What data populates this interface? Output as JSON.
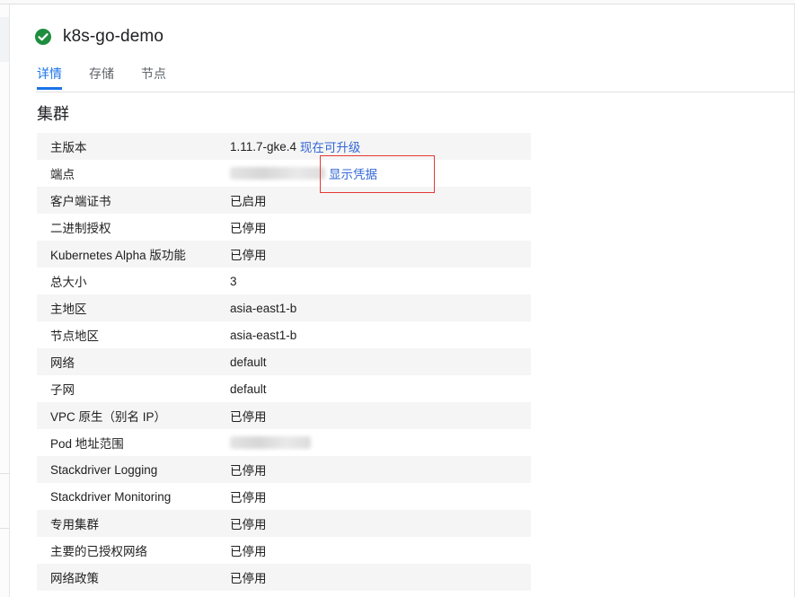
{
  "header": {
    "cluster_name": "k8s-go-demo",
    "status_color": "#1e8e3e"
  },
  "tabs": [
    {
      "label": "详情",
      "active": true
    },
    {
      "label": "存储",
      "active": false
    },
    {
      "label": "节点",
      "active": false
    }
  ],
  "section_title": "集群",
  "rows": {
    "master_version": {
      "label": "主版本",
      "value": "1.11.7-gke.4",
      "link": "现在可升级"
    },
    "endpoint": {
      "label": "端点",
      "link": "显示凭据"
    },
    "client_cert": {
      "label": "客户端证书",
      "value": "已启用"
    },
    "binary_auth": {
      "label": "二进制授权",
      "value": "已停用"
    },
    "k8s_alpha": {
      "label": "Kubernetes Alpha 版功能",
      "value": "已停用"
    },
    "total_size": {
      "label": "总大小",
      "value": "3"
    },
    "master_zone": {
      "label": "主地区",
      "value": "asia-east1-b"
    },
    "node_zones": {
      "label": "节点地区",
      "value": "asia-east1-b"
    },
    "network": {
      "label": "网络",
      "link": "default"
    },
    "subnet": {
      "label": "子网",
      "link": "default"
    },
    "vpc_native": {
      "label": "VPC 原生（别名 IP）",
      "value": "已停用"
    },
    "pod_range": {
      "label": "Pod 地址范围"
    },
    "sd_logging": {
      "label": "Stackdriver Logging",
      "value": "已停用"
    },
    "sd_monitoring": {
      "label": "Stackdriver Monitoring",
      "value": "已停用"
    },
    "private_cluster": {
      "label": "专用集群",
      "value": "已停用"
    },
    "master_auth_networks": {
      "label": "主要的已授权网络",
      "value": "已停用"
    },
    "network_policy": {
      "label": "网络政策",
      "value": "已停用"
    }
  }
}
